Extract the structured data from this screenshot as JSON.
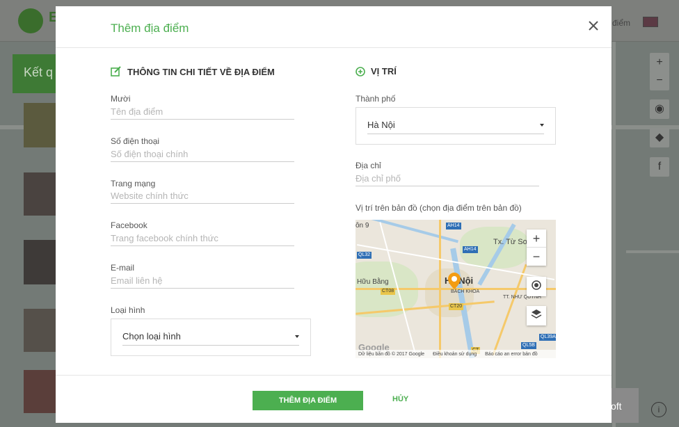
{
  "background": {
    "lang_text": "điểm",
    "green_panel_text": "Kết q",
    "ad_text": "oft"
  },
  "modal": {
    "title": "Thêm địa điểm",
    "left_section": {
      "title": "THÔNG TIN CHI TIẾT VỀ ĐỊA ĐIỂM",
      "icon": "edit-icon",
      "fields": [
        {
          "label": "Mười",
          "placeholder": "Tên địa điểm"
        },
        {
          "label": "Số điện thoại",
          "placeholder": "Số điện thoại chính"
        },
        {
          "label": "Trang mạng",
          "placeholder": "Website chính thức"
        },
        {
          "label": "Facebook",
          "placeholder": "Trang facebook chính thức"
        },
        {
          "label": "E-mail",
          "placeholder": "Email liên hệ"
        }
      ],
      "type_label": "Loại hình",
      "type_value": "Chọn loại hình"
    },
    "right_section": {
      "title": "VỊ TRÍ",
      "icon": "plus-circle-icon",
      "city_label": "Thành phố",
      "city_value": "Hà Nội",
      "address_label": "Địa chỉ",
      "address_placeholder": "Địa chỉ phố",
      "map_label": "Vị trí trên bản đồ (chọn địa điểm trên bản đồ)"
    },
    "map": {
      "city": "Hà Nội",
      "labels": [
        "Tx. Từ Sơn",
        "Hữu Bằng",
        "BÁCH KHOA",
        "TT. NHƯ QUỲNH",
        "ôn 9"
      ],
      "road_tags": [
        "AH14",
        "AH14",
        "QL32",
        "CT08",
        "CT20",
        "QL5B",
        "QL39A",
        "CT"
      ],
      "zoom_in": "+",
      "zoom_out": "−",
      "footer": [
        "Dữ liệu bản đồ © 2017 Google",
        "Điều khoản sử dụng",
        "Báo cáo an error bản đồ"
      ],
      "google": "Google"
    },
    "footer": {
      "add_label": "THÊM ĐỊA ĐIỂM",
      "cancel_label": "HỦY"
    },
    "accent_color": "#4caf50"
  }
}
